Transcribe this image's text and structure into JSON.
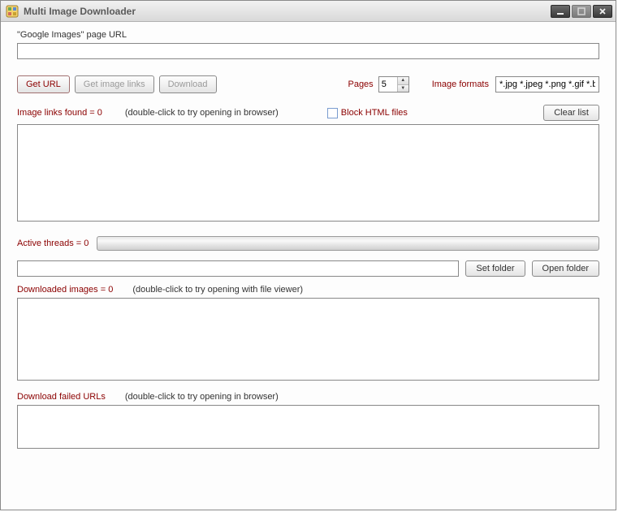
{
  "titlebar": {
    "title": "Multi Image Downloader"
  },
  "url_section": {
    "label": "\"Google Images\" page URL",
    "value": ""
  },
  "buttons": {
    "get_url": "Get URL",
    "get_image_links": "Get image links",
    "download": "Download",
    "clear_list": "Clear list",
    "set_folder": "Set folder",
    "open_folder": "Open folder"
  },
  "pages": {
    "label": "Pages",
    "value": "5"
  },
  "formats": {
    "label": "Image formats",
    "value": "*.jpg *.jpeg *.png *.gif *.b"
  },
  "links": {
    "label": "Image links found = 0",
    "hint": "(double-click to try opening in browser)"
  },
  "block_html": {
    "label": "Block HTML files",
    "checked": false
  },
  "threads": {
    "label": "Active threads = 0"
  },
  "folder": {
    "value": ""
  },
  "downloaded": {
    "label": "Downloaded images = 0",
    "hint": "(double-click to try opening with file viewer)"
  },
  "failed": {
    "label": "Download failed URLs",
    "hint": "(double-click to try opening in browser)"
  }
}
